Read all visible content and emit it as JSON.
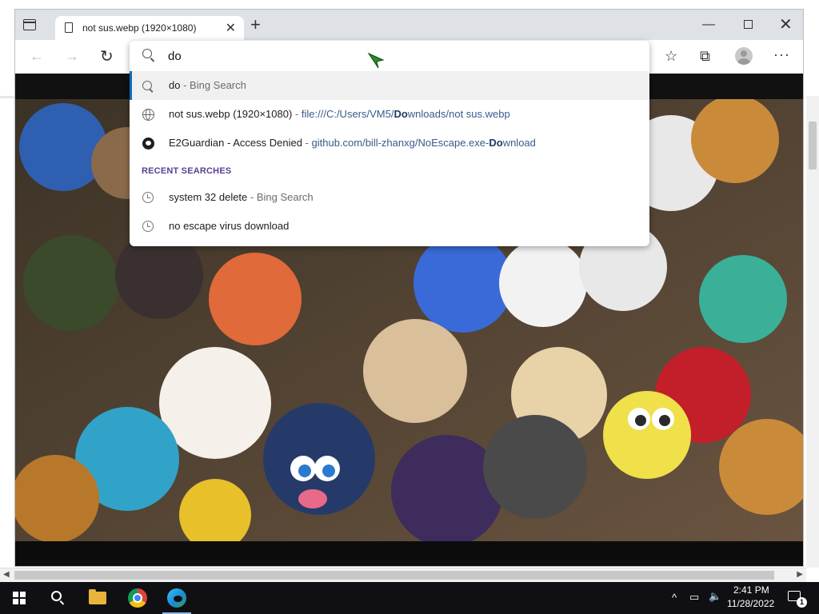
{
  "tab": {
    "title": "not sus.webp (1920×1080)",
    "close_glyph": "✕"
  },
  "new_tab_glyph": "+",
  "window_controls": {
    "minimize": "—",
    "close": "✕"
  },
  "toolbar": {
    "back_glyph": "←",
    "forward_glyph": "→",
    "refresh_glyph": "↻",
    "favorites_glyph": "☆",
    "collections_glyph": "⧉",
    "more_glyph": "···"
  },
  "omnibox": {
    "value": "do",
    "suggestions": [
      {
        "icon": "search-icon",
        "text": "do",
        "sep": " - ",
        "sub": "Bing Search"
      },
      {
        "icon": "globe-icon",
        "text": "not sus.webp (1920×1080)",
        "sep": " - ",
        "url_pre": "file:///C:/Users/VM5/",
        "url_bold": "Do",
        "url_post": "wnloads/not sus.webp"
      },
      {
        "icon": "github-icon",
        "text": "E2Guardian - Access Denied",
        "sep": " - ",
        "url_pre": "github.com/bill-zhanxg/NoEscape.exe-",
        "url_bold": "Do",
        "url_post": "wnload"
      }
    ],
    "recent_header": "RECENT SEARCHES",
    "recent": [
      {
        "icon": "history-icon",
        "text": "system 32 delete",
        "sep": " - ",
        "sub": "Bing Search"
      },
      {
        "icon": "history-icon",
        "text": "no escape virus download"
      }
    ]
  },
  "scrollbar": {
    "left_arrow": "◀",
    "right_arrow": "▶"
  },
  "taskbar": {
    "time": "2:41 PM",
    "date": "11/28/2022",
    "tray_up": "^",
    "notification_count": "1"
  },
  "colors": {
    "accent": "#0f6cbd",
    "recent_header": "#5a3f8f",
    "taskbar": "#101014"
  }
}
